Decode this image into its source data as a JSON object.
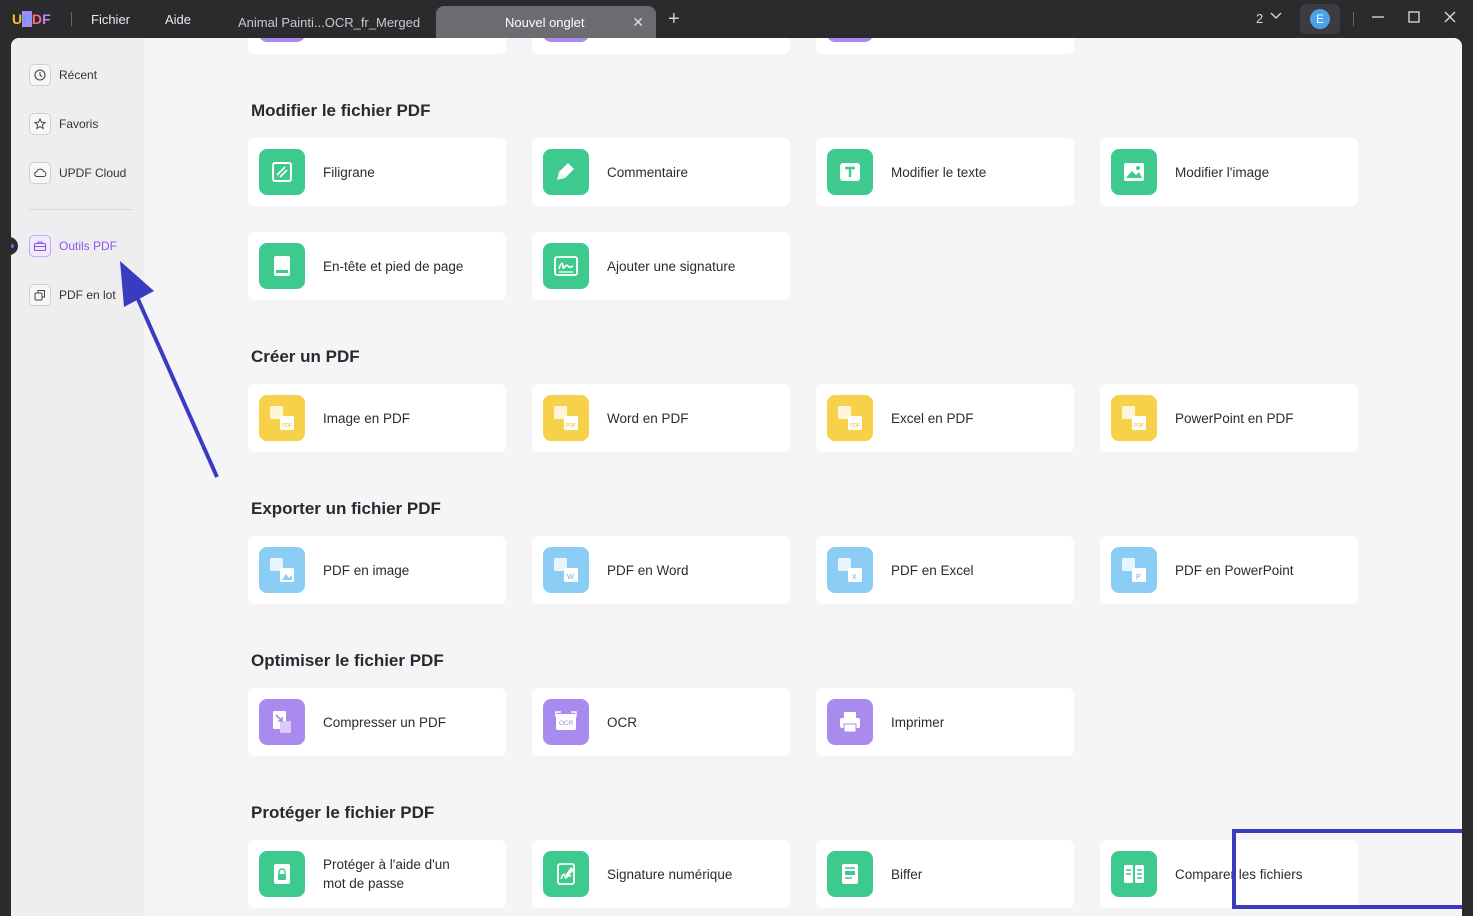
{
  "app": {
    "logo": "UPDF",
    "menu": [
      "Fichier",
      "Aide"
    ],
    "tabs": [
      {
        "label": "Animal Painti...OCR_fr_Merged",
        "active": false
      },
      {
        "label": "Nouvel onglet",
        "active": true
      }
    ],
    "doc_count": "2",
    "avatar_letter": "E"
  },
  "sidebar": {
    "items": [
      {
        "label": "Récent",
        "icon": "clock-icon"
      },
      {
        "label": "Favoris",
        "icon": "star-icon"
      },
      {
        "label": "UPDF Cloud",
        "icon": "cloud-icon"
      },
      {
        "label": "Outils PDF",
        "icon": "toolbox-icon",
        "active": true
      },
      {
        "label": "PDF en lot",
        "icon": "copy-icon"
      }
    ]
  },
  "sections": [
    {
      "title": "Modifier le fichier PDF",
      "tools": [
        "Filigrane",
        "Commentaire",
        "Modifier le texte",
        "Modifier l'image",
        "En-tête et pied de page",
        "Ajouter une signature"
      ]
    },
    {
      "title": "Créer un PDF",
      "tools": [
        "Image en PDF",
        "Word en PDF",
        "Excel en PDF",
        "PowerPoint en PDF"
      ]
    },
    {
      "title": "Exporter un fichier PDF",
      "tools": [
        "PDF en image",
        "PDF en Word",
        "PDF en Excel",
        "PDF en PowerPoint"
      ]
    },
    {
      "title": "Optimiser le fichier PDF",
      "tools": [
        "Compresser un PDF",
        "OCR",
        "Imprimer"
      ]
    },
    {
      "title": "Protéger le fichier PDF",
      "tools": [
        "Protéger à l'aide d'un mot de passe",
        "Signature numérique",
        "Biffer",
        "Comparer les fichiers"
      ]
    }
  ],
  "colors": {
    "modify": "#3ec98e",
    "create": "#f7d14a",
    "export": "#8ccdf5",
    "optimize": "#a98bef",
    "protect": "#3ec98e",
    "annotation": "#3a3cc0",
    "active_sidebar": "#8f54ea"
  }
}
